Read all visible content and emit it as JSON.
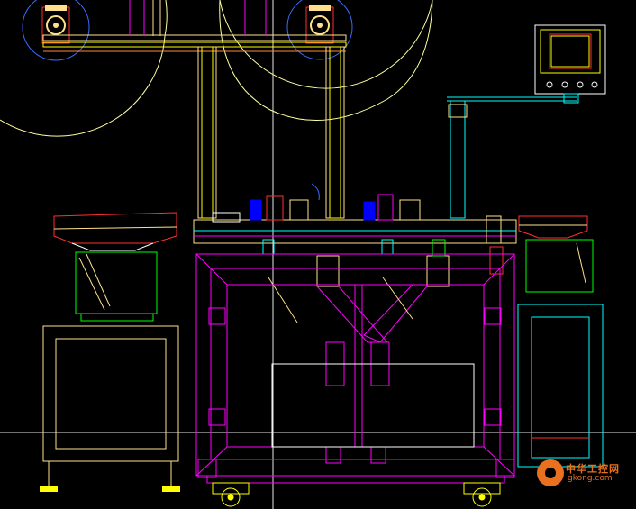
{
  "drawing": {
    "colors": {
      "background": "#000000",
      "frame": "#ff00ff",
      "structure": "#ffff00",
      "profile": "#ffe08a",
      "guide": "#00ffff",
      "feeder": "#00ff00",
      "cabinet": "#ffffff",
      "motor": "#0000ff",
      "bracket": "#ff3030",
      "crosshair": "#ffffff",
      "arc": "#ffffa0"
    },
    "icons": [
      "reel-icon",
      "hmi-panel-icon",
      "caster-wheel-icon",
      "leveling-foot-icon",
      "gear-icon"
    ]
  },
  "watermark": {
    "text_zh": "中华工控网",
    "text_en": "gkong.com",
    "color": "#e8701e"
  }
}
